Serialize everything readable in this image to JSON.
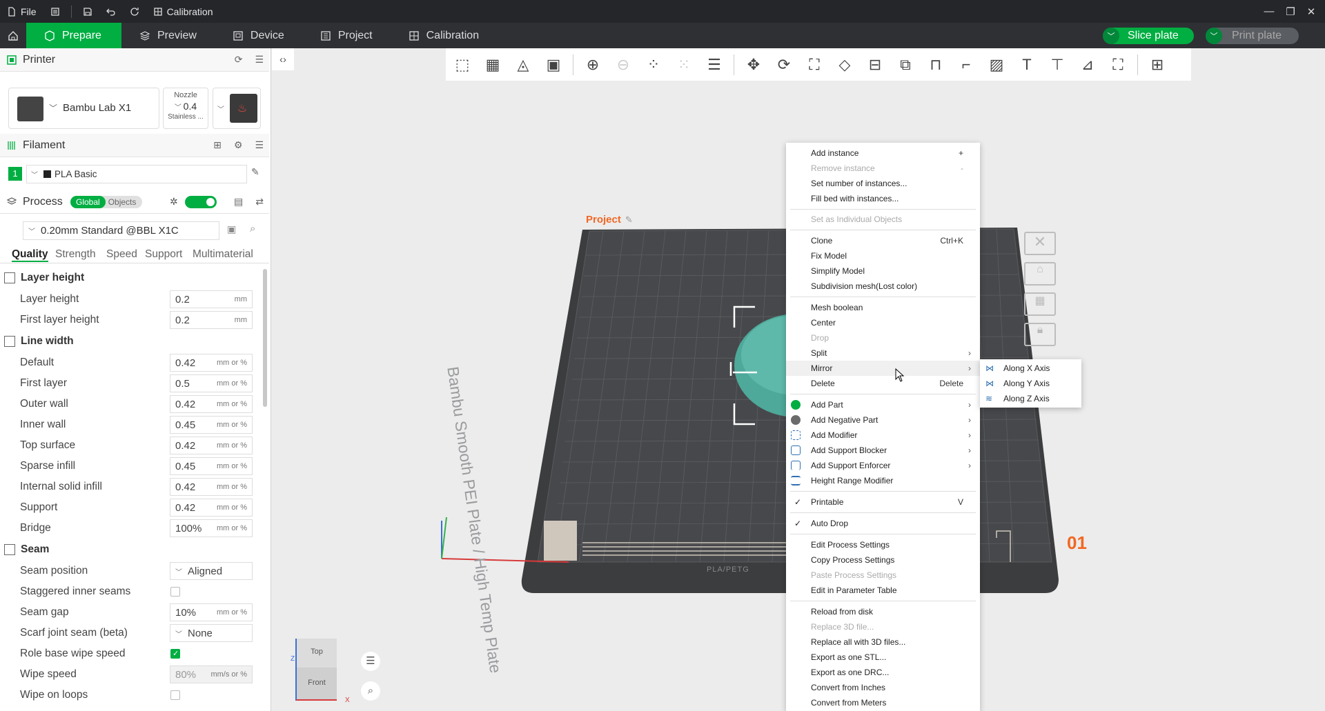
{
  "titlebar": {
    "file_label": "File",
    "project_name": "Calibration"
  },
  "tabs": {
    "items": [
      {
        "label": "Prepare"
      },
      {
        "label": "Preview"
      },
      {
        "label": "Device"
      },
      {
        "label": "Project"
      },
      {
        "label": "Calibration"
      }
    ],
    "slice_label": "Slice plate",
    "print_label": "Print plate"
  },
  "colors": {
    "accent": "#00ae42",
    "plate": "#3c3d3f",
    "project_label": "#f26722"
  },
  "sidebar": {
    "printer": {
      "title": "Printer",
      "name": "Bambu Lab X1",
      "nozzle_label": "Nozzle",
      "nozzle_value": "0.4",
      "nozzle_type": "Stainless ..."
    },
    "filament": {
      "title": "Filament",
      "slot": "1",
      "name": "PLA Basic"
    },
    "process": {
      "title": "Process",
      "mode_global": "Global",
      "mode_objects": "Objects",
      "preset": "0.20mm Standard @BBL X1C",
      "tabs": [
        "Quality",
        "Strength",
        "Speed",
        "Support",
        "Multimaterial"
      ]
    },
    "groups": {
      "layer_height": "Layer height",
      "line_width": "Line width",
      "seam": "Seam"
    },
    "layer_height_rows": [
      {
        "label": "Layer height",
        "value": "0.2",
        "unit": "mm"
      },
      {
        "label": "First layer height",
        "value": "0.2",
        "unit": "mm"
      }
    ],
    "line_width_rows": [
      {
        "label": "Default",
        "value": "0.42",
        "unit": "mm or %"
      },
      {
        "label": "First layer",
        "value": "0.5",
        "unit": "mm or %"
      },
      {
        "label": "Outer wall",
        "value": "0.42",
        "unit": "mm or %"
      },
      {
        "label": "Inner wall",
        "value": "0.45",
        "unit": "mm or %"
      },
      {
        "label": "Top surface",
        "value": "0.42",
        "unit": "mm or %"
      },
      {
        "label": "Sparse infill",
        "value": "0.45",
        "unit": "mm or %"
      },
      {
        "label": "Internal solid infill",
        "value": "0.42",
        "unit": "mm or %"
      },
      {
        "label": "Support",
        "value": "0.42",
        "unit": "mm or %"
      },
      {
        "label": "Bridge",
        "value": "100%",
        "unit": "mm or %"
      }
    ],
    "seam_rows": {
      "seam_position": {
        "label": "Seam position",
        "value": "Aligned"
      },
      "staggered": {
        "label": "Staggered inner seams"
      },
      "seam_gap": {
        "label": "Seam gap",
        "value": "10%",
        "unit": "mm or %"
      },
      "scarf": {
        "label": "Scarf joint seam (beta)",
        "value": "None"
      },
      "role_wipe": {
        "label": "Role base wipe speed"
      },
      "wipe_speed": {
        "label": "Wipe speed",
        "value": "80%",
        "unit": "mm/s or %"
      },
      "wipe_loops": {
        "label": "Wipe on loops"
      }
    }
  },
  "viewport": {
    "project_label": "Project",
    "plate_text": "Bambu Smooth PEI Plate / High Temp Plate",
    "plate_number": "01",
    "plate_footer": "PLA/PETG",
    "cube_top": "Top",
    "cube_front": "Front",
    "axis_x": "X",
    "axis_z": "Z"
  },
  "context_menu": {
    "items": [
      {
        "label": "Add instance",
        "acc": "+",
        "disabled": false
      },
      {
        "label": "Remove instance",
        "acc": "-",
        "disabled": true
      },
      {
        "label": "Set number of instances...",
        "acc": "",
        "disabled": false
      },
      {
        "label": "Fill bed with instances...",
        "acc": "",
        "disabled": false
      },
      {
        "label": "Set as Individual Objects",
        "acc": "",
        "disabled": true
      },
      {
        "label": "Clone",
        "acc": "Ctrl+K",
        "disabled": false
      },
      {
        "label": "Fix Model",
        "acc": "",
        "disabled": false
      },
      {
        "label": "Simplify Model",
        "acc": "",
        "disabled": false
      },
      {
        "label": "Subdivision mesh(Lost color)",
        "acc": "",
        "disabled": false
      },
      {
        "label": "Mesh boolean",
        "acc": "",
        "disabled": false
      },
      {
        "label": "Center",
        "acc": "",
        "disabled": false
      },
      {
        "label": "Drop",
        "acc": "",
        "disabled": true
      },
      {
        "label": "Split",
        "acc": "",
        "disabled": false
      },
      {
        "label": "Mirror",
        "acc": "",
        "disabled": false
      },
      {
        "label": "Delete",
        "acc": "Delete",
        "disabled": false
      },
      {
        "label": "Add Part",
        "acc": "",
        "disabled": false
      },
      {
        "label": "Add Negative Part",
        "acc": "",
        "disabled": false
      },
      {
        "label": "Add Modifier",
        "acc": "",
        "disabled": false
      },
      {
        "label": "Add Support Blocker",
        "acc": "",
        "disabled": false
      },
      {
        "label": "Add Support Enforcer",
        "acc": "",
        "disabled": false
      },
      {
        "label": "Height Range Modifier",
        "acc": "",
        "disabled": false
      },
      {
        "label": "Printable",
        "acc": "V",
        "disabled": false,
        "checked": true
      },
      {
        "label": "Auto Drop",
        "acc": "",
        "disabled": false,
        "checked": true
      },
      {
        "label": "Edit Process Settings",
        "acc": "",
        "disabled": false
      },
      {
        "label": "Copy Process Settings",
        "acc": "",
        "disabled": false
      },
      {
        "label": "Paste Process Settings",
        "acc": "",
        "disabled": true
      },
      {
        "label": "Edit in Parameter Table",
        "acc": "",
        "disabled": false
      },
      {
        "label": "Reload from disk",
        "acc": "",
        "disabled": false
      },
      {
        "label": "Replace 3D file...",
        "acc": "",
        "disabled": true
      },
      {
        "label": "Replace all with 3D files...",
        "acc": "",
        "disabled": false
      },
      {
        "label": "Export as one STL...",
        "acc": "",
        "disabled": false
      },
      {
        "label": "Export as one DRC...",
        "acc": "",
        "disabled": false
      },
      {
        "label": "Convert from Inches",
        "acc": "",
        "disabled": false
      },
      {
        "label": "Convert from Meters",
        "acc": "",
        "disabled": false
      }
    ]
  },
  "mirror_submenu": {
    "items": [
      {
        "label": "Along X Axis"
      },
      {
        "label": "Along Y Axis"
      },
      {
        "label": "Along Z Axis"
      }
    ]
  }
}
